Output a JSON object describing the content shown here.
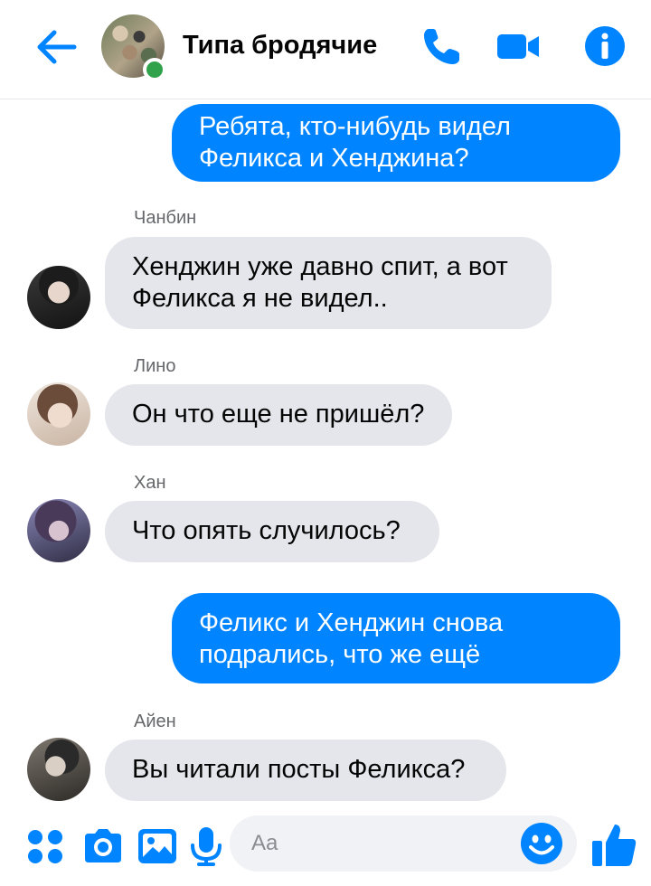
{
  "header": {
    "title": "Типа бродячие",
    "online": true
  },
  "messages": [
    {
      "direction": "outgoing",
      "text": "Ребята, кто-нибудь видел\nФеликса и Хенджина?"
    },
    {
      "direction": "incoming",
      "sender": "Чанбин",
      "text": "Хенджин уже давно спит, а вот\nФеликса я не видел.."
    },
    {
      "direction": "incoming",
      "sender": "Лино",
      "text": "Он что еще не пришёл?"
    },
    {
      "direction": "incoming",
      "sender": "Хан",
      "text": "Что опять случилось?"
    },
    {
      "direction": "outgoing",
      "text": "Феликс и Хенджин снова\nподрались, что же ещё"
    },
    {
      "direction": "incoming",
      "sender": "Айен",
      "text": "Вы читали посты Феликса?"
    }
  ],
  "composer": {
    "placeholder": "Aa",
    "value": ""
  },
  "icons": {
    "back": "arrow-left-icon",
    "call": "phone-icon",
    "video": "video-camera-icon",
    "info": "info-icon",
    "apps": "apps-grid-icon",
    "camera": "camera-icon",
    "gallery": "image-icon",
    "mic": "microphone-icon",
    "emoji": "smiley-icon",
    "like": "thumbs-up-icon"
  },
  "colors": {
    "accent": "#0084ff",
    "online": "#31a24c",
    "incoming_bubble": "#e4e6eb",
    "sender_name": "#65676b"
  }
}
